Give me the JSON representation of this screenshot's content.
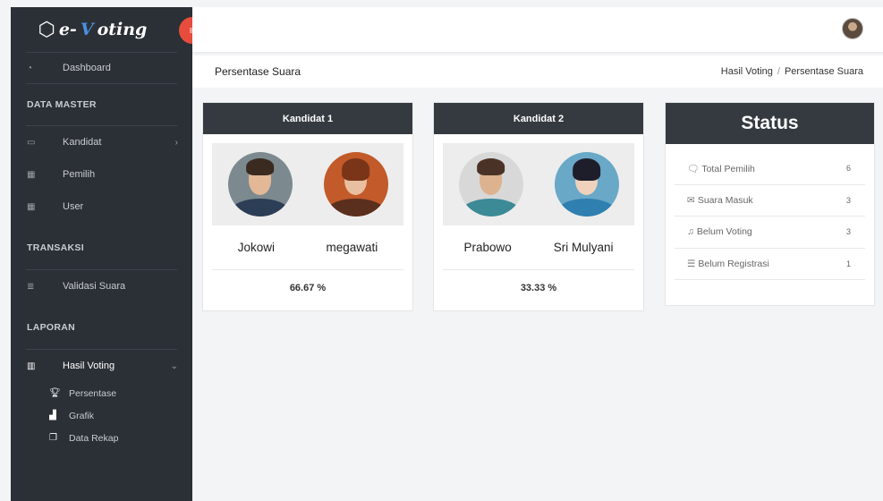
{
  "brand": {
    "prefix": "e-",
    "v": "V",
    "suffix": "oting",
    "box_icon": "⬡"
  },
  "sidebar": {
    "dashboard": "Dashboard",
    "sections": {
      "data_master": "DATA MASTER",
      "transaksi": "TRANSAKSI",
      "laporan": "LAPORAN"
    },
    "items": {
      "kandidat": "Kandidat",
      "pemilih": "Pemilih",
      "user": "User",
      "validasi": "Validasi Suara",
      "hasil_voting": "Hasil Voting"
    },
    "subitems": {
      "persentase": "Persentase",
      "grafik": "Grafik",
      "data_rekap": "Data Rekap"
    }
  },
  "titlebar": {
    "title": "Persentase Suara",
    "crumb_parent": "Hasil Voting",
    "crumb_sep": "/",
    "crumb_current": "Persentase Suara"
  },
  "candidates": [
    {
      "header": "Kandidat 1",
      "name1": "Jokowi",
      "name2": "megawati",
      "percent": "66.67 %"
    },
    {
      "header": "Kandidat 2",
      "name1": "Prabowo",
      "name2": "Sri Mulyani",
      "percent": "33.33 %"
    }
  ],
  "status": {
    "title": "Status",
    "rows": [
      {
        "label": "Total Pemilih",
        "value": "6",
        "icon": "comments-icon"
      },
      {
        "label": "Suara Masuk",
        "value": "3",
        "icon": "envelope-icon"
      },
      {
        "label": "Belum Voting",
        "value": "3",
        "icon": "bell-icon"
      },
      {
        "label": "Belum Registrasi",
        "value": "1",
        "icon": "list-icon"
      }
    ]
  },
  "colors": {
    "sidebar_bg": "#2b3036",
    "card_header": "#343a40",
    "toggle_button": "#e74c3c",
    "brand_accent": "#4a90e2"
  }
}
